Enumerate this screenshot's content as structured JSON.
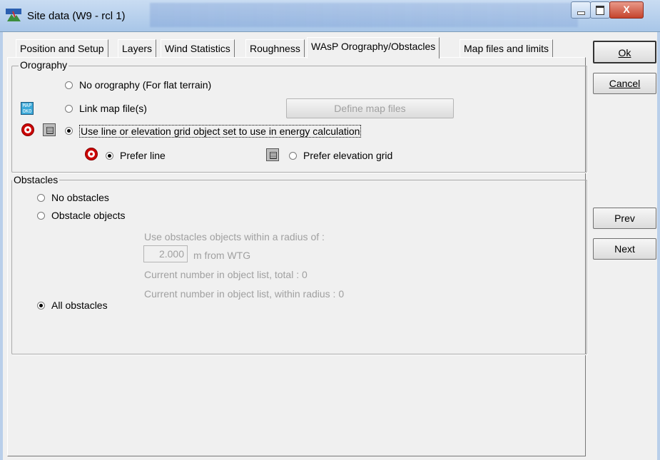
{
  "window": {
    "title": "Site data  (W9 - rcl 1)",
    "close_glyph": "X"
  },
  "tabs": [
    "Position and Setup",
    "Layers",
    "Wind Statistics",
    "Roughness",
    "WAsP Orography/Obstacles",
    "Map files and limits"
  ],
  "active_tab_index": 4,
  "orography": {
    "legend": "Orography",
    "no_orography": "No orography (For flat terrain)",
    "link_map": "Link map file(s)",
    "map_icon_text": "MAP OKO",
    "define_map_files": "Define map files",
    "use_line_or_grid": "Use line or elevation grid object set to use in energy calculation",
    "prefer_line": "Prefer line",
    "prefer_grid": "Prefer elevation grid",
    "selected": "use_line_or_grid",
    "preference": "prefer_line"
  },
  "obstacles": {
    "legend": "Obstacles",
    "no_obstacles": "No obstacles",
    "obstacle_objects": "Obstacle objects",
    "radius_prompt": "Use obstacles objects within a radius of :",
    "radius_value": "2.000",
    "radius_unit": "m from WTG",
    "count_total": "Current number in object list, total : 0",
    "count_radius": "Current number in object list, within radius : 0",
    "all_obstacles": "All obstacles",
    "selected": "all_obstacles"
  },
  "buttons": {
    "ok": "Ok",
    "cancel": "Cancel",
    "prev": "Prev",
    "next": "Next"
  }
}
